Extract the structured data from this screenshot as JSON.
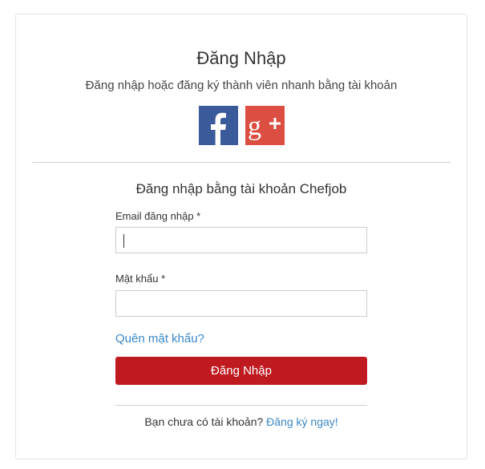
{
  "login": {
    "title": "Đăng Nhập",
    "subtitle": "Đăng nhập hoặc đăng ký thành viên nhanh bằng tài khoản",
    "social": [
      {
        "name": "facebook-icon",
        "glyph": "f",
        "color": "#3b5a9a"
      },
      {
        "name": "google-plus-icon",
        "glyph": "g+",
        "color": "#dc4e41"
      }
    ],
    "section_title": "Đăng nhập bằng tài khoản Chefjob",
    "email_label": "Email đăng nhập *",
    "email_value": "",
    "password_label": "Mật khẩu *",
    "password_value": "",
    "forgot_link": "Quên mật khẩu?",
    "submit_label": "Đăng Nhập",
    "submit_color": "#be1a1f",
    "no_account_text": "Bạn chưa có tài khoản?",
    "register_link": "Đăng ký ngay!",
    "link_color": "#3a87c6"
  }
}
